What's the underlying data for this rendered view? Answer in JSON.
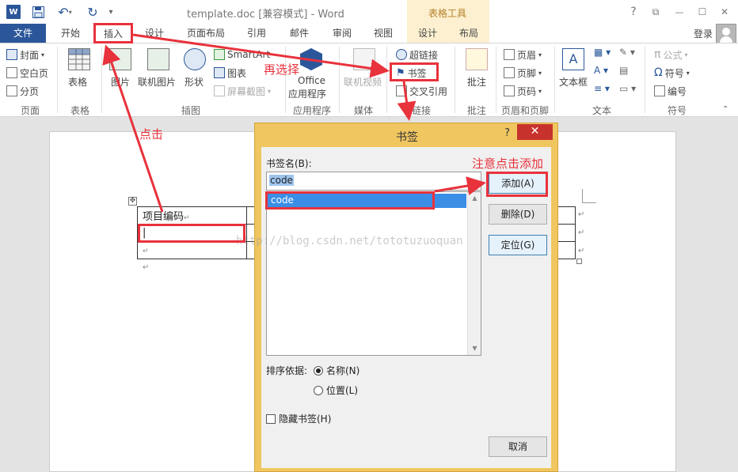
{
  "titlebar": {
    "logo": "W",
    "doc_title": "template.doc [兼容模式] - Word",
    "tool_group": "表格工具",
    "help": "?",
    "restore": "⧉",
    "minimize": "—",
    "maximize": "☐",
    "close": "✕"
  },
  "tabs": {
    "file": "文件",
    "home": "开始",
    "insert": "插入",
    "design": "设计",
    "layout": "页面布局",
    "references": "引用",
    "mailings": "邮件",
    "review": "审阅",
    "view": "视图",
    "table_design": "设计",
    "table_layout": "布局",
    "login": "登录"
  },
  "ribbon": {
    "cover": "封面",
    "blank_page": "空白页",
    "page_break": "分页",
    "group_pages": "页面",
    "table": "表格",
    "group_table": "表格",
    "pictures": "图片",
    "online_pictures": "联机图片",
    "shapes": "形状",
    "smartart": "SmartArt",
    "chart": "图表",
    "screenshot": "屏幕截图",
    "group_illustrations": "插图",
    "office_apps": "Office",
    "office_apps_2": "应用程序",
    "group_apps": "应用程序",
    "online_video": "联机视频",
    "group_media": "媒体",
    "hyperlink": "超链接",
    "bookmark": "书签",
    "cross_reference": "交叉引用",
    "group_links": "链接",
    "comment": "批注",
    "group_comments": "批注",
    "header": "页眉",
    "footer": "页脚",
    "page_number": "页码",
    "group_header_footer": "页眉和页脚",
    "text_box": "文本框",
    "group_text": "文本",
    "equation": "公式",
    "symbol": "符号",
    "numbering": "编号",
    "group_symbols": "符号"
  },
  "document": {
    "cell_project_code": "项目编码",
    "cell_cursor": "|",
    "pilcrow": "↵",
    "table_handle": "✥"
  },
  "dialog": {
    "title": "书签",
    "help": "?",
    "close": "✕",
    "name_label": "书签名(B):",
    "name_value": "code",
    "list_items": [
      "code"
    ],
    "add_button": "添加(A)",
    "delete_button": "删除(D)",
    "goto_button": "定位(G)",
    "sort_label": "排序依据:",
    "sort_name": "名称(N)",
    "sort_location": "位置(L)",
    "hidden_bookmarks": "隐藏书签(H)",
    "cancel_button": "取消"
  },
  "annotations": {
    "click": "点击",
    "then_select": "再选择",
    "note_add": "注意点击添加",
    "watermark": "http://blog.csdn.net/tototuzuoquan",
    "color": "#e8323c"
  }
}
